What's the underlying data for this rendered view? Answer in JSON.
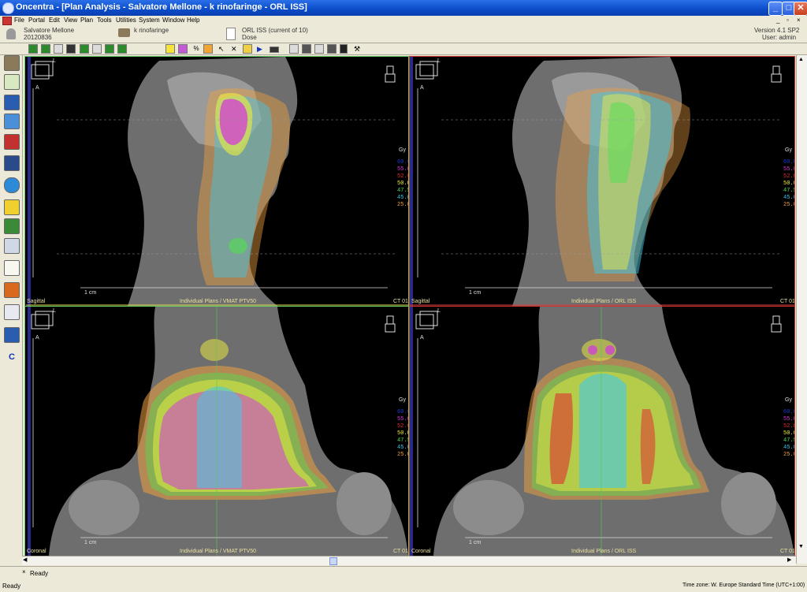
{
  "window": {
    "title": "Oncentra - [Plan Analysis - Salvatore Mellone - k rinofaringe - ORL ISS]",
    "minimize": "_",
    "maximize": "□",
    "close": "✕"
  },
  "menu": [
    "File",
    "Portal",
    "Edit",
    "View",
    "Plan",
    "Tools",
    "Utilities",
    "System",
    "Window",
    "Help"
  ],
  "info": {
    "patient_name": "Salvatore Mellone",
    "patient_id": "20120836",
    "case": "k rinofaringe",
    "plan": "ORL ISS (current of 10)",
    "dose": "Dose",
    "version": "Version 4.1 SP2",
    "user": "User: admin"
  },
  "viewports": [
    {
      "view": "Sagittal",
      "plan": "Individual Plans / VMAT PTV50",
      "ct": "CT 01",
      "scale": "1 cm",
      "unit": "Gy",
      "orient_a": "A",
      "orient_l": "L"
    },
    {
      "view": "Sagittal",
      "plan": "Individual Plans / ORL ISS",
      "ct": "CT 01",
      "scale": "1 cm",
      "unit": "Gy",
      "orient_a": "A",
      "orient_l": "L"
    },
    {
      "view": "Coronal",
      "plan": "Individual Plans / VMAT PTV50",
      "ct": "CT 01",
      "scale": "1 cm",
      "unit": "Gy",
      "orient_a": "A",
      "orient_l": "L"
    },
    {
      "view": "Coronal",
      "plan": "Individual Plans / ORL ISS",
      "ct": "CT 01",
      "scale": "1 cm",
      "unit": "Gy",
      "orient_a": "A",
      "orient_l": "L"
    }
  ],
  "isodose_legend": [
    {
      "value": "60.0",
      "color": "#1b3fd6"
    },
    {
      "value": "55.0",
      "color": "#d23cd8"
    },
    {
      "value": "52.0",
      "color": "#e03030"
    },
    {
      "value": "50.0",
      "color": "#f0f040"
    },
    {
      "value": "47.5",
      "color": "#50e050"
    },
    {
      "value": "45.0",
      "color": "#40c8e8"
    },
    {
      "value": "25.0",
      "color": "#f0a040"
    }
  ],
  "status": {
    "left": "Ready",
    "right": "Time zone: W. Europe Standard Time (UTC+1:00)"
  },
  "icons": {
    "app": "oncentra-logo-icon",
    "sidebar": [
      "patient-icon",
      "import-icon",
      "export-icon",
      "contour-icon",
      "book-icon",
      "safe-icon",
      "organ-icon",
      "beam-icon",
      "ruler-icon",
      "plan-icon",
      "report-icon",
      "warning-icon",
      "dvh-icon",
      "send-icon",
      "ce-icon"
    ]
  }
}
